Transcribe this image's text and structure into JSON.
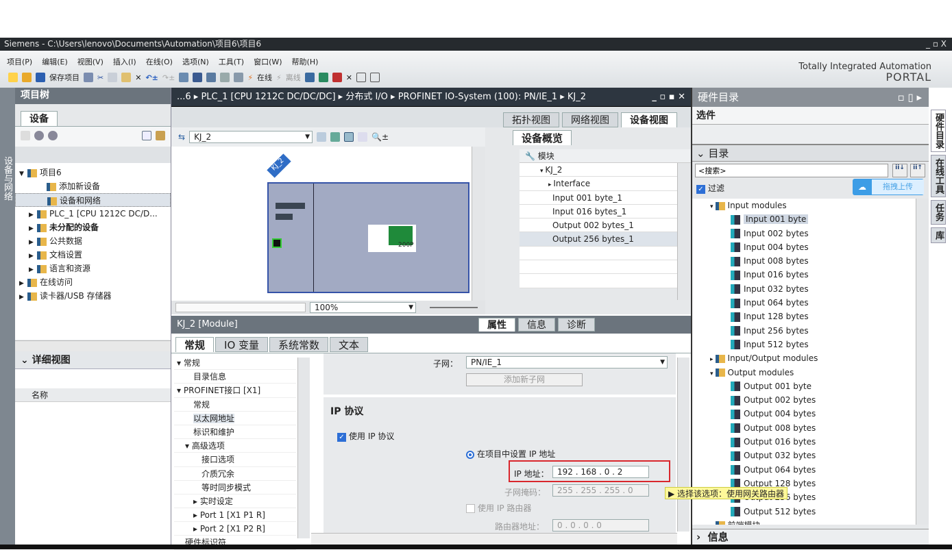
{
  "window": {
    "title": "Siemens  -  C:\\Users\\lenovo\\Documents\\Automation\\项目6\\项目6",
    "controls": "_ ▫ X"
  },
  "menu": [
    "项目(P)",
    "编辑(E)",
    "视图(V)",
    "插入(I)",
    "在线(O)",
    "选项(N)",
    "工具(T)",
    "窗口(W)",
    "帮助(H)"
  ],
  "toolbar": {
    "save": "保存项目",
    "online": "在线",
    "offline": "离线"
  },
  "brand": {
    "line1": "Totally Integrated Automation",
    "line2": "PORTAL"
  },
  "left_strip": "设备与网络",
  "project_tree": {
    "title": "项目树",
    "tab": "设备",
    "items": [
      {
        "label": "项目6",
        "level": 0,
        "exp": "▼"
      },
      {
        "label": "添加新设备",
        "level": 2,
        "exp": ""
      },
      {
        "label": "设备和网络",
        "level": 2,
        "exp": "",
        "selected": true
      },
      {
        "label": "PLC_1 [CPU 1212C DC/D...",
        "level": 1,
        "exp": "▶"
      },
      {
        "label": "未分配的设备",
        "level": 1,
        "exp": "▶",
        "bold": true
      },
      {
        "label": "公共数据",
        "level": 1,
        "exp": "▶"
      },
      {
        "label": "文档设置",
        "level": 1,
        "exp": "▶"
      },
      {
        "label": "语言和资源",
        "level": 1,
        "exp": "▶"
      },
      {
        "label": "在线访问",
        "level": 0,
        "exp": "▶"
      },
      {
        "label": "读卡器/USB 存储器",
        "level": 0,
        "exp": "▶"
      }
    ]
  },
  "detail_view": {
    "title": "详细视图",
    "column": "名称"
  },
  "breadcrumb": "...6 ▸ PLC_1 [CPU 1212C DC/DC/DC] ▸ 分布式 I/O ▸ PROFINET IO-System (100): PN/IE_1 ▸ KJ_2",
  "view_tabs": [
    "拓扑视图",
    "网络视图",
    "设备视图"
  ],
  "device_view": {
    "device_select": "KJ_2",
    "device_label": "KJ_2",
    "module_label": "200P",
    "zoom": "100%"
  },
  "overview": {
    "title": "设备概览",
    "column": "模块",
    "rows": [
      "KJ_2",
      "Interface",
      "Input 001 byte_1",
      "Input 016 bytes_1",
      "Output 002 bytes_1",
      "Output 256 bytes_1"
    ]
  },
  "inspector": {
    "title": "KJ_2 [Module]",
    "tabs_right": [
      "属性",
      "信息",
      "诊断"
    ],
    "tabs": [
      "常规",
      "IO 变量",
      "系统常数",
      "文本"
    ],
    "nav": [
      {
        "label": "▾ 常规",
        "i": 0
      },
      {
        "label": "目录信息",
        "i": 2
      },
      {
        "label": "▾ PROFINET接口 [X1]",
        "i": 0
      },
      {
        "label": "常规",
        "i": 2
      },
      {
        "label": "以太网地址",
        "i": 2
      },
      {
        "label": "标识和维护",
        "i": 2
      },
      {
        "label": "▾ 高级选项",
        "i": 1
      },
      {
        "label": "接口选项",
        "i": 3
      },
      {
        "label": "介质冗余",
        "i": 3
      },
      {
        "label": "等时同步模式",
        "i": 3
      },
      {
        "label": "▸ 实时设定",
        "i": 2
      },
      {
        "label": "▸ Port 1 [X1 P1 R]",
        "i": 2
      },
      {
        "label": "▸ Port 2 [X1 P2 R]",
        "i": 2
      },
      {
        "label": "硬件标识符",
        "i": 1
      }
    ],
    "subnet_label": "子网：",
    "subnet": "PN/IE_1",
    "add_subnet": "添加新子网",
    "ip_section": "IP 协议",
    "use_ip": "使用 IP 协议",
    "set_in_project": "在项目中设置 IP 地址",
    "ip_label": "IP 地址：",
    "ip": "192 . 168 . 0   . 2",
    "mask_label": "子网掩码：",
    "mask": "255 . 255 . 255 . 0",
    "use_router": "使用 IP 路由器",
    "router_label": "路由器地址：",
    "router": "0    . 0    . 0    . 0"
  },
  "tooltip": "▶ 选择该选项：使用网关路由器",
  "catalog": {
    "title": "硬件目录",
    "options": "选件",
    "catalog": "目录",
    "search_placeholder": "<搜索>",
    "filter": "过滤",
    "upload": "拖拽上传",
    "items": [
      {
        "t": "Input modules",
        "f": 1
      },
      {
        "t": "Input 001 byte",
        "sel": 1
      },
      {
        "t": "Input 002 bytes"
      },
      {
        "t": "Input 004 bytes"
      },
      {
        "t": "Input 008 bytes"
      },
      {
        "t": "Input 016 bytes"
      },
      {
        "t": "Input 032 bytes"
      },
      {
        "t": "Input 064 bytes"
      },
      {
        "t": "Input 128 bytes"
      },
      {
        "t": "Input 256 bytes"
      },
      {
        "t": "Input 512 bytes"
      },
      {
        "t": "Input/Output modules",
        "f": 1,
        "c": 1
      },
      {
        "t": "Output modules",
        "f": 1
      },
      {
        "t": "Output 001 byte"
      },
      {
        "t": "Output 002 bytes"
      },
      {
        "t": "Output 004 bytes"
      },
      {
        "t": "Output 008 bytes"
      },
      {
        "t": "Output 016 bytes"
      },
      {
        "t": "Output 032 bytes"
      },
      {
        "t": "Output 064 bytes"
      },
      {
        "t": "Output 128 bytes"
      },
      {
        "t": "Output 256 bytes"
      },
      {
        "t": "Output 512 bytes"
      },
      {
        "t": "前端模块",
        "f": 1,
        "c": 1
      }
    ],
    "info": "信息"
  },
  "right_tabs": [
    "硬件目录",
    "在线工具",
    "任务",
    "库"
  ]
}
